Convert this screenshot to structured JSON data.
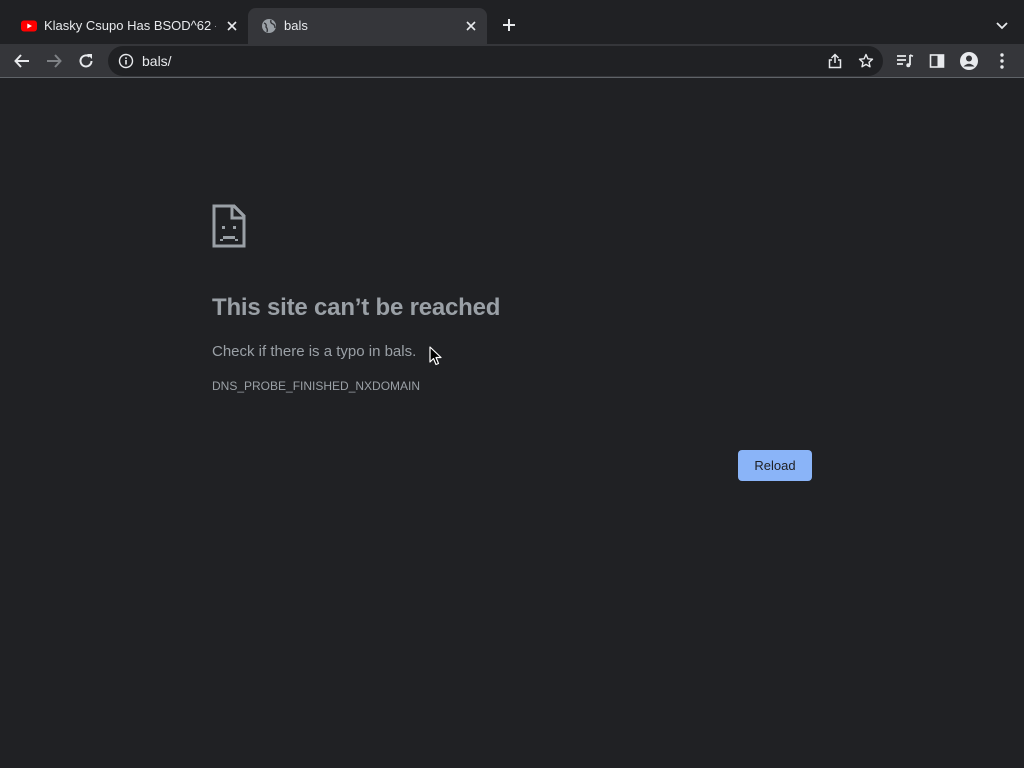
{
  "tabs": [
    {
      "title": "Klasky Csupo Has BSOD^62 -",
      "favicon": "youtube-icon",
      "active": false
    },
    {
      "title": "bals",
      "favicon": "globe-icon",
      "active": true
    }
  ],
  "toolbar": {
    "url": "bals/",
    "icons": [
      "back-arrow-icon",
      "forward-arrow-icon",
      "reload-icon",
      "info-icon",
      "share-icon",
      "star-icon",
      "media-queue-icon",
      "side-panel-icon",
      "profile-icon",
      "menu-dots-icon"
    ]
  },
  "error_page": {
    "heading": "This site can’t be reached",
    "message": "Check if there is a typo in bals.",
    "error_code": "DNS_PROBE_FINISHED_NXDOMAIN",
    "reload_label": "Reload"
  },
  "colors": {
    "background": "#202124",
    "toolbar": "#35363a",
    "text_muted": "#9aa0a6",
    "accent": "#8ab4f8",
    "youtube_red": "#ff0000"
  }
}
